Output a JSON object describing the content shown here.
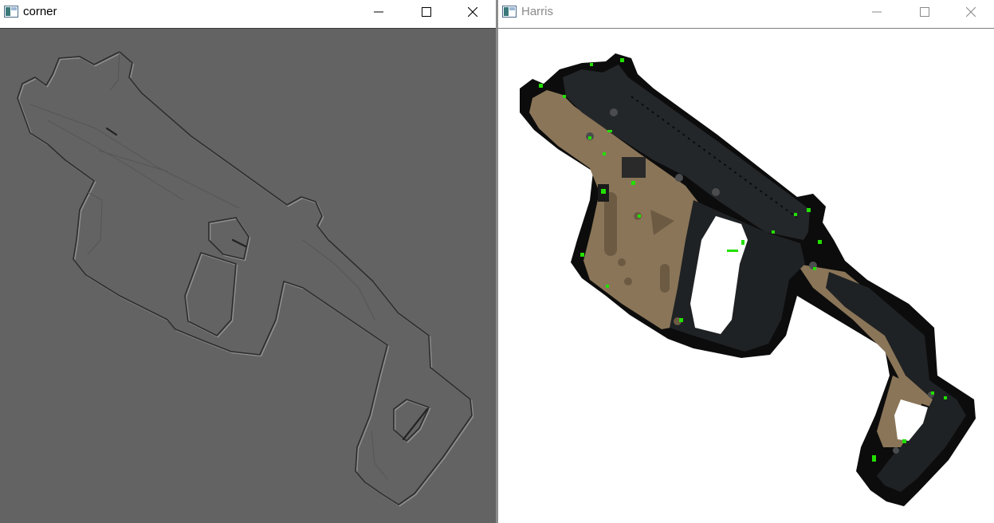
{
  "windows": {
    "corner": {
      "title": "corner",
      "icon": "opencv-window-icon",
      "active": true,
      "image": "edge-response-of-submachine-gun"
    },
    "harris": {
      "title": "Harris",
      "icon": "opencv-window-icon",
      "active": false,
      "image": "submachine-gun-with-green-corner-markers"
    }
  },
  "controls": [
    "minimize-icon",
    "maximize-icon",
    "close-icon"
  ],
  "colors": {
    "corner_background": "#636363",
    "harris_background": "#ffffff",
    "corner_marker": "#22e000",
    "gun_tan": "#8a7558",
    "gun_black": "#1e2022"
  }
}
